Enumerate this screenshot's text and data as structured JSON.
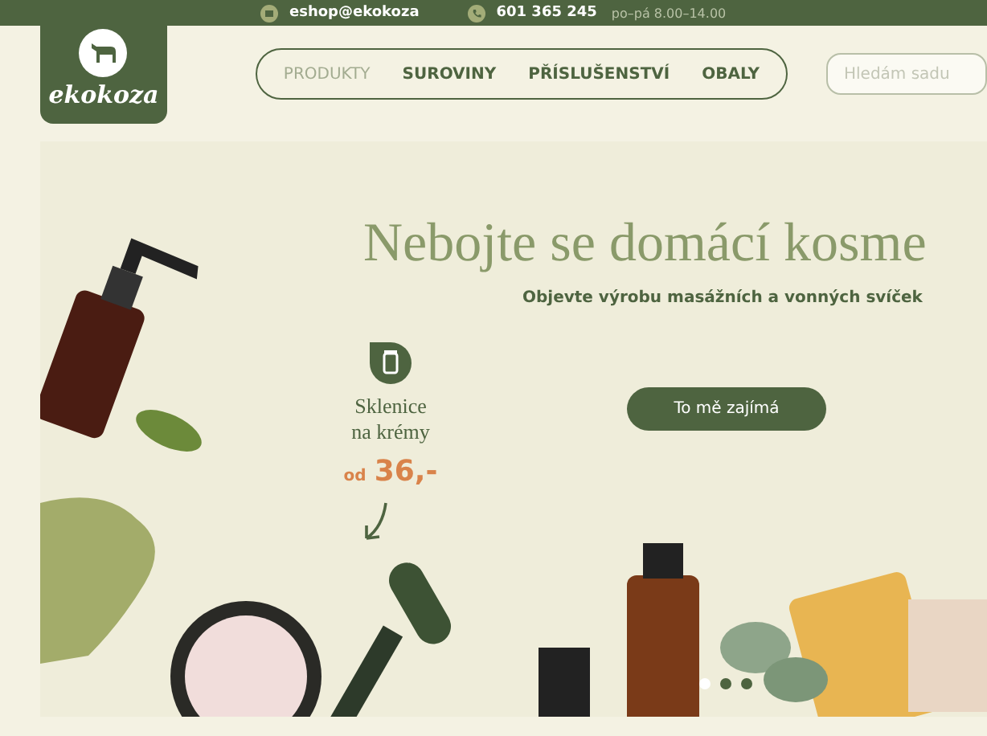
{
  "top_bar": {
    "email": "eshop@ekokoza",
    "phone": "601 365 245",
    "hours": "po–pá 8.00–14.00"
  },
  "logo": {
    "text": "ekokoza"
  },
  "nav": [
    {
      "label": "PRODUKTY",
      "selected": true
    },
    {
      "label": "SUROVINY",
      "selected": false
    },
    {
      "label": "PŘÍSLUŠENSTVÍ",
      "selected": false
    },
    {
      "label": "OBALY",
      "selected": false
    }
  ],
  "search": {
    "placeholder": "Hledám sadu"
  },
  "hero": {
    "title": "Nebojte se domácí kosme",
    "subtitle": "Objevte výrobu masážních a vonných svíček",
    "button": "To mě zajímá",
    "promo": {
      "name": "Sklenice na krémy",
      "prefix": "od",
      "price": "36,-"
    },
    "dots": [
      {
        "selected": true
      },
      {
        "selected": false
      },
      {
        "selected": false
      }
    ]
  }
}
